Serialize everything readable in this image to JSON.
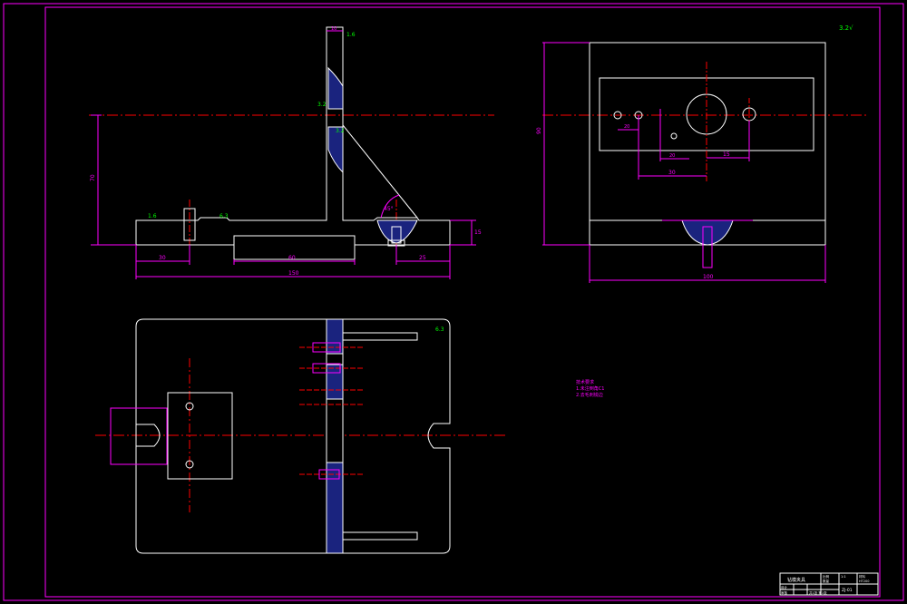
{
  "colors": {
    "background": "#000000",
    "outline": "#ffffff",
    "dimension": "#ff00ff",
    "centerline": "#ff0000",
    "section_fill": "#1a237e",
    "annotation": "#00ff00",
    "frame": "#ff00ff"
  },
  "dimensions": {
    "v_total_height": "70",
    "v_base_height": "15",
    "h_base_left": "30",
    "h_slot": "60",
    "h_right": "25",
    "h_total": "150",
    "top_width": "10",
    "side_height": "90",
    "front_total": "100",
    "front_a": "30",
    "front_b": "15",
    "front_c": "20",
    "front_d": "20"
  },
  "annotations": {
    "roughness_corner": "3.2√",
    "roughness_a": "1.6",
    "roughness_b": "3.2",
    "roughness_c": "3.2",
    "roughness_d": "1.6",
    "roughness_e": "6.3",
    "angle": "45°"
  },
  "notes": {
    "line1": "技术要求",
    "line2": "1.未注倒角C1",
    "line3": "2.去毛刺锐边"
  },
  "title_block": {
    "name": "钻模夹具",
    "drawing_no": "ZJ-01",
    "scale_label": "比例",
    "scale": "1:1",
    "qty_label": "数量",
    "material_label": "材料",
    "material": "HT200",
    "designer_label": "设计",
    "checker_label": "审核",
    "sheet": "共1张 第1张"
  }
}
